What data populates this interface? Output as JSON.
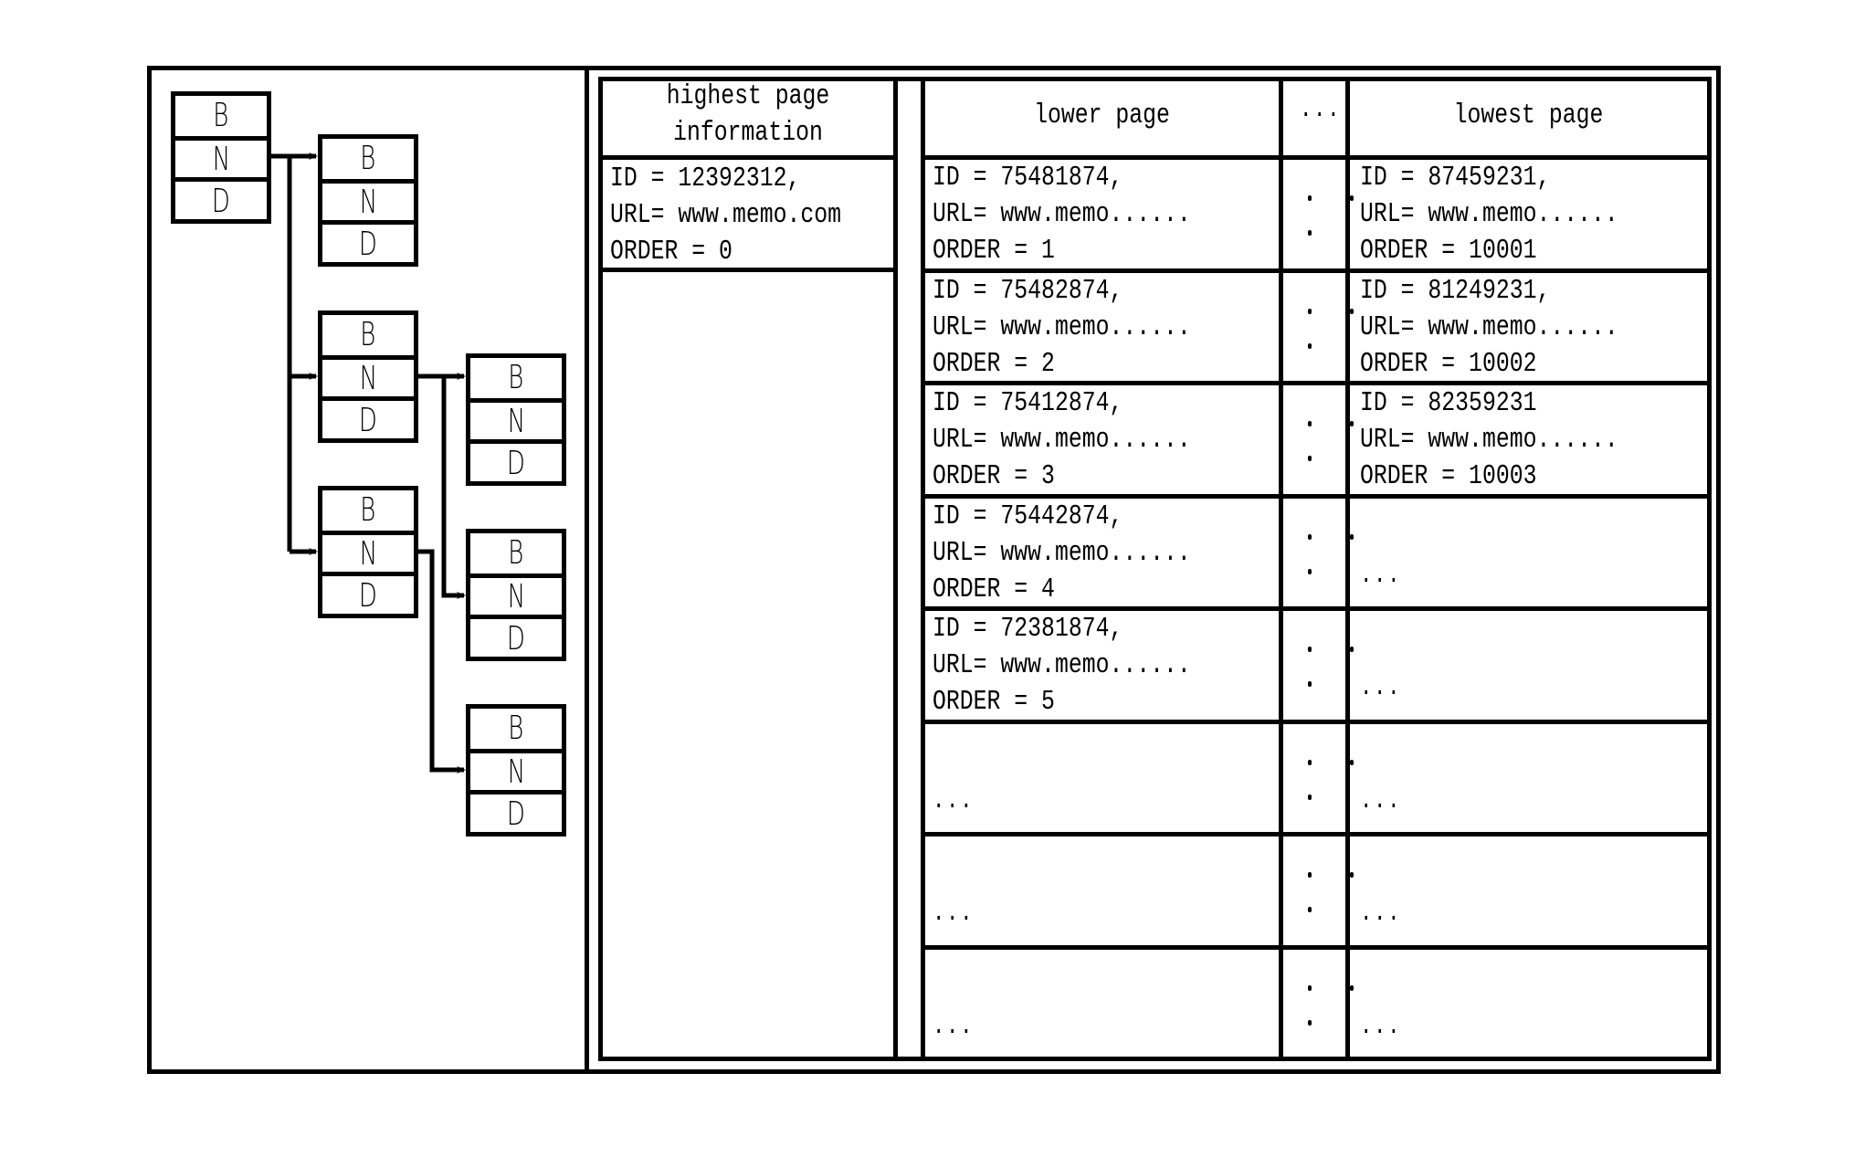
{
  "tree": {
    "node_fields": [
      "B",
      "N",
      "D"
    ],
    "nodes": [
      {
        "id": "root",
        "fields": [
          "B",
          "N",
          "D"
        ]
      },
      {
        "id": "child-1",
        "fields": [
          "B",
          "N",
          "D"
        ]
      },
      {
        "id": "child-2",
        "fields": [
          "B",
          "N",
          "D"
        ]
      },
      {
        "id": "child-3",
        "fields": [
          "B",
          "N",
          "D"
        ]
      },
      {
        "id": "grandchild-1",
        "fields": [
          "B",
          "N",
          "D"
        ]
      },
      {
        "id": "grandchild-2",
        "fields": [
          "B",
          "N",
          "D"
        ]
      },
      {
        "id": "grandchild-3",
        "fields": [
          "B",
          "N",
          "D"
        ]
      }
    ],
    "edges": [
      [
        "root",
        "child-1"
      ],
      [
        "root",
        "child-2"
      ],
      [
        "root",
        "child-3"
      ],
      [
        "child-2",
        "grandchild-1"
      ],
      [
        "child-2",
        "grandchild-2"
      ],
      [
        "child-3",
        "grandchild-3"
      ]
    ]
  },
  "table": {
    "headers": {
      "highest": "highest page\ninformation",
      "lower": "lower page",
      "middle": "...",
      "lowest": "lowest page"
    },
    "highest_rows": [
      "ID = 12392312,\nURL= www.memo.com\nORDER = 0"
    ],
    "lower_rows": [
      "ID = 75481874,\nURL= www.memo......\nORDER = 1",
      "ID = 75482874,\nURL= www.memo......\nORDER = 2",
      "ID = 75412874,\nURL= www.memo......\nORDER = 3",
      "ID = 75442874,\nURL= www.memo......\nORDER = 4",
      "ID = 72381874,\nURL= www.memo......\nORDER = 5",
      "...",
      "...",
      "..."
    ],
    "lowest_rows": [
      "ID = 87459231,\nURL= www.memo......\nORDER = 10001",
      "ID = 81249231,\nURL= www.memo......\nORDER = 10002",
      "ID = 82359231\nURL= www.memo......\nORDER = 10003",
      "...",
      "...",
      "...",
      "...",
      "..."
    ],
    "middle_cell_glyph": "vertical-ellipsis"
  }
}
